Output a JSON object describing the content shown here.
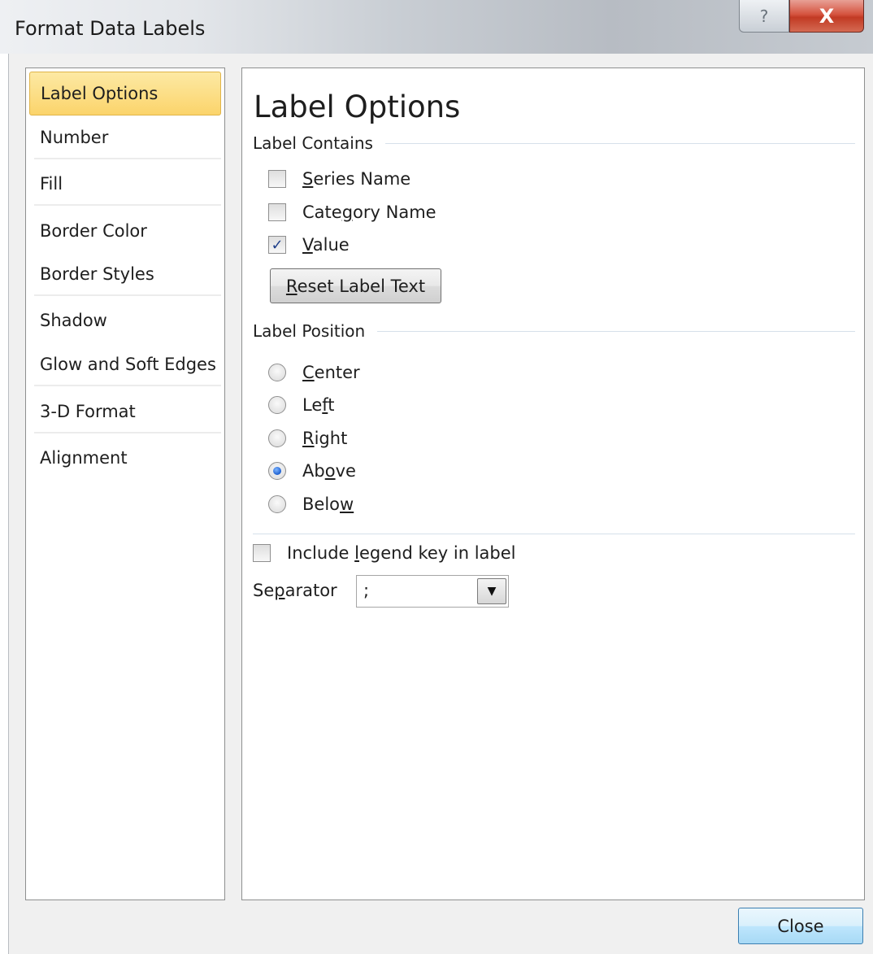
{
  "window": {
    "title": "Format Data Labels",
    "help_icon": "?",
    "close_icon": "X"
  },
  "nav": {
    "items": [
      {
        "label": "Label Options",
        "selected": true
      },
      {
        "label": "Number"
      },
      {
        "label": "Fill"
      },
      {
        "label": "Border Color"
      },
      {
        "label": "Border Styles"
      },
      {
        "label": "Shadow"
      },
      {
        "label": "Glow and Soft Edges"
      },
      {
        "label": "3-D Format"
      },
      {
        "label": "Alignment"
      }
    ]
  },
  "panel": {
    "heading": "Label Options",
    "label_contains": {
      "title": "Label Contains",
      "series_name": {
        "mn": "S",
        "rest": "eries Name",
        "checked": false
      },
      "category_name": {
        "pre": "Cate",
        "mn": "g",
        "rest": "ory Name",
        "checked": false
      },
      "value": {
        "mn": "V",
        "rest": "alue",
        "checked": true,
        "check_glyph": "✓"
      }
    },
    "reset_button": {
      "mn": "R",
      "rest": "eset Label Text"
    },
    "label_position": {
      "title": "Label Position",
      "center": {
        "mn": "C",
        "rest": "enter",
        "checked": false
      },
      "left": {
        "pre": "Le",
        "mn": "f",
        "rest": "t",
        "checked": false
      },
      "right": {
        "mn": "R",
        "rest": "ight",
        "checked": false
      },
      "above": {
        "pre": "Ab",
        "mn": "o",
        "rest": "ve",
        "checked": true
      },
      "below": {
        "pre": "Belo",
        "mn": "w",
        "rest": "",
        "checked": false
      }
    },
    "legend_key": {
      "pre": "Include ",
      "mn": "l",
      "rest": "egend key in label",
      "checked": false
    },
    "separator": {
      "pre": "Se",
      "mn": "p",
      "rest": "arator",
      "value": ";",
      "arrow": "▼"
    }
  },
  "footer": {
    "close_label": "Close"
  }
}
